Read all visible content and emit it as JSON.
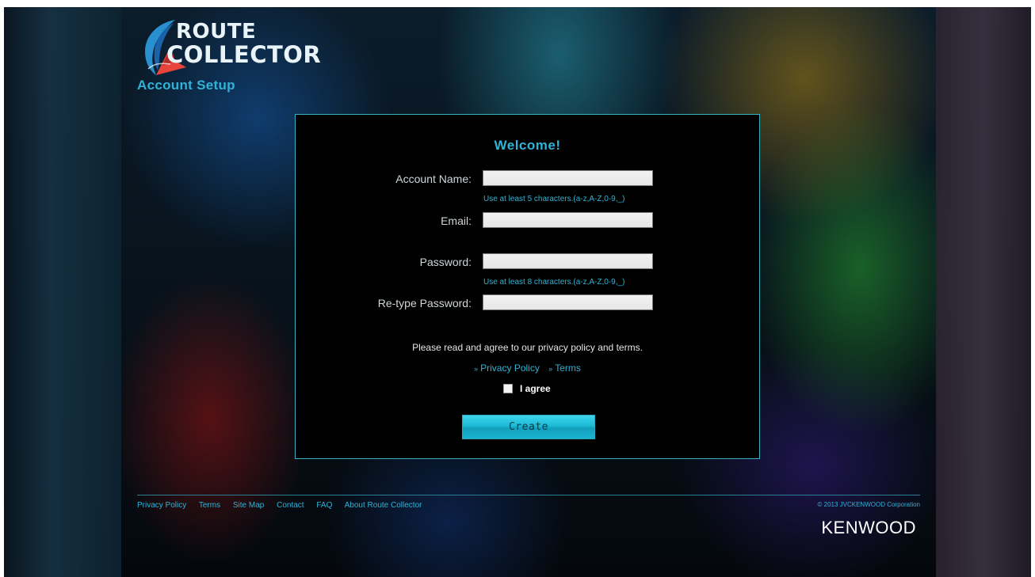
{
  "brand": {
    "logo_line1": "ROUTE",
    "logo_line2": "COLLECTOR"
  },
  "page": {
    "heading": "Account Setup"
  },
  "form": {
    "welcome": "Welcome!",
    "fields": [
      {
        "label": "Account Name:",
        "value": "",
        "hint": "Use at least 5 characters.(a-z,A-Z,0-9,_)"
      },
      {
        "label": "Email:",
        "value": "",
        "hint": ""
      },
      {
        "label": "Password:",
        "value": "",
        "hint": "Use at least 8 characters.(a-z,A-Z,0-9,_)"
      },
      {
        "label": "Re-type Password:",
        "value": "",
        "hint": ""
      }
    ],
    "agreement_text": "Please read and agree to our privacy policy and terms.",
    "links": [
      "Privacy Policy",
      "Terms"
    ],
    "link_marker": "»",
    "agree_label": "I agree",
    "agree_checked": false,
    "submit_label": "Create"
  },
  "footer": {
    "links": [
      "Privacy Policy",
      "Terms",
      "Site Map",
      "Contact",
      "FAQ",
      "About Route Collector"
    ],
    "copyright": "© 2013 JVCKENWOOD Corporation",
    "brand_logo": "KENWOOD"
  },
  "colors": {
    "accent": "#2fb3d6",
    "panel_background": "#000000",
    "button": "#1cbad6"
  },
  "icons": {
    "logo_mark": "swoosh-arrow-icon",
    "checkbox": "checkbox-unchecked-icon"
  }
}
